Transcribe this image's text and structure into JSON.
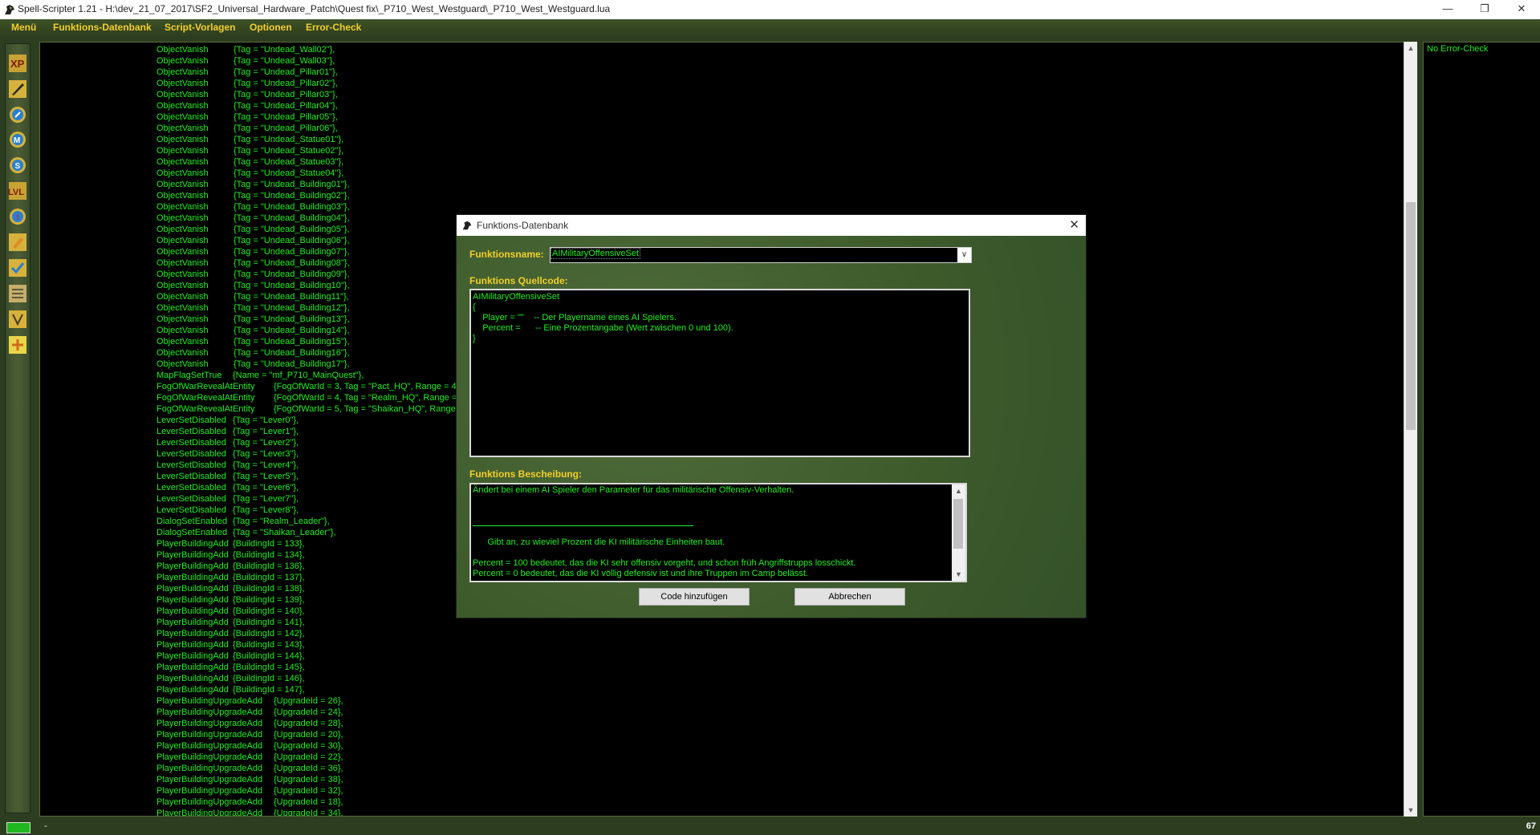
{
  "window": {
    "title": "Spell-Scripter 1.21 - H:\\dev_21_07_2017\\SF2_Universal_Hardware_Patch\\Quest fix\\_P710_West_Westguard\\_P710_West_Westguard.lua",
    "minimize": "—",
    "maximize": "❐",
    "close": "✕"
  },
  "menu": [
    "Menü",
    "Funktions-Datenbank",
    "Script-Vorlagen",
    "Optionen",
    "Error-Check"
  ],
  "toolbar": {
    "icons": [
      "xp-icon",
      "shovel-icon",
      "compass-icon",
      "m-icon",
      "s-icon",
      "lvl-icon",
      "info-icon",
      "pencil-icon",
      "check-icon",
      "list-icon",
      "map-icon",
      "plus-icon"
    ],
    "labels": {
      "xp": "XP",
      "lvl": "LVL",
      "m": "M",
      "s": "S",
      "info": "!"
    }
  },
  "code_lines": [
    [
      "ObjectVanish",
      "{Tag = \"Undead_Wall02\"},"
    ],
    [
      "ObjectVanish",
      "{Tag = \"Undead_Wall03\"},"
    ],
    [
      "ObjectVanish",
      "{Tag = \"Undead_Pillar01\"},"
    ],
    [
      "ObjectVanish",
      "{Tag = \"Undead_Pillar02\"},"
    ],
    [
      "ObjectVanish",
      "{Tag = \"Undead_Pillar03\"},"
    ],
    [
      "ObjectVanish",
      "{Tag = \"Undead_Pillar04\"},"
    ],
    [
      "ObjectVanish",
      "{Tag = \"Undead_Pillar05\"},"
    ],
    [
      "ObjectVanish",
      "{Tag = \"Undead_Pillar06\"},"
    ],
    [
      "ObjectVanish",
      "{Tag = \"Undead_Statue01\"},"
    ],
    [
      "ObjectVanish",
      "{Tag = \"Undead_Statue02\"},"
    ],
    [
      "ObjectVanish",
      "{Tag = \"Undead_Statue03\"},"
    ],
    [
      "ObjectVanish",
      "{Tag = \"Undead_Statue04\"},"
    ],
    [
      "ObjectVanish",
      "{Tag = \"Undead_Building01\"},"
    ],
    [
      "ObjectVanish",
      "{Tag = \"Undead_Building02\"},"
    ],
    [
      "ObjectVanish",
      "{Tag = \"Undead_Building03\"},"
    ],
    [
      "ObjectVanish",
      "{Tag = \"Undead_Building04\"},"
    ],
    [
      "ObjectVanish",
      "{Tag = \"Undead_Building05\"},"
    ],
    [
      "ObjectVanish",
      "{Tag = \"Undead_Building06\"},"
    ],
    [
      "ObjectVanish",
      "{Tag = \"Undead_Building07\"},"
    ],
    [
      "ObjectVanish",
      "{Tag = \"Undead_Building08\"},"
    ],
    [
      "ObjectVanish",
      "{Tag = \"Undead_Building09\"},"
    ],
    [
      "ObjectVanish",
      "{Tag = \"Undead_Building10\"},"
    ],
    [
      "ObjectVanish",
      "{Tag = \"Undead_Building11\"},"
    ],
    [
      "ObjectVanish",
      "{Tag = \"Undead_Building12\"},"
    ],
    [
      "ObjectVanish",
      "{Tag = \"Undead_Building13\"},"
    ],
    [
      "ObjectVanish",
      "{Tag = \"Undead_Building14\"},"
    ],
    [
      "ObjectVanish",
      "{Tag = \"Undead_Building15\"},"
    ],
    [
      "ObjectVanish",
      "{Tag = \"Undead_Building16\"},"
    ],
    [
      "ObjectVanish",
      "{Tag = \"Undead_Building17\"},"
    ],
    [
      "MapFlagSetTrue",
      "{Name = \"mf_P710_MainQuest\"},"
    ],
    [
      "FogOfWarRevealAtEntity",
      "{FogOfWarId = 3, Tag = \"Pact_HQ\", Range = 40"
    ],
    [
      "FogOfWarRevealAtEntity",
      "{FogOfWarId = 4, Tag = \"Realm_HQ\", Range = 4"
    ],
    [
      "FogOfWarRevealAtEntity",
      "{FogOfWarId = 5, Tag = \"Shaikan_HQ\", Range ="
    ],
    [
      "LeverSetDisabled",
      "{Tag = \"Lever0\"},"
    ],
    [
      "LeverSetDisabled",
      "{Tag = \"Lever1\"},"
    ],
    [
      "LeverSetDisabled",
      "{Tag = \"Lever2\"},"
    ],
    [
      "LeverSetDisabled",
      "{Tag = \"Lever3\"},"
    ],
    [
      "LeverSetDisabled",
      "{Tag = \"Lever4\"},"
    ],
    [
      "LeverSetDisabled",
      "{Tag = \"Lever5\"},"
    ],
    [
      "LeverSetDisabled",
      "{Tag = \"Lever6\"},"
    ],
    [
      "LeverSetDisabled",
      "{Tag = \"Lever7\"},"
    ],
    [
      "LeverSetDisabled",
      "{Tag = \"Lever8\"},"
    ],
    [
      "DialogSetEnabled",
      "{Tag = \"Realm_Leader\"},"
    ],
    [
      "DialogSetEnabled",
      "{Tag = \"Shaikan_Leader\"},"
    ],
    [
      "PlayerBuildingAdd",
      "{BuildingId = 133},"
    ],
    [
      "PlayerBuildingAdd",
      "{BuildingId = 134},"
    ],
    [
      "PlayerBuildingAdd",
      "{BuildingId = 136},"
    ],
    [
      "PlayerBuildingAdd",
      "{BuildingId = 137},"
    ],
    [
      "PlayerBuildingAdd",
      "{BuildingId = 138},"
    ],
    [
      "PlayerBuildingAdd",
      "{BuildingId = 139},"
    ],
    [
      "PlayerBuildingAdd",
      "{BuildingId = 140},"
    ],
    [
      "PlayerBuildingAdd",
      "{BuildingId = 141},"
    ],
    [
      "PlayerBuildingAdd",
      "{BuildingId = 142},"
    ],
    [
      "PlayerBuildingAdd",
      "{BuildingId = 143},"
    ],
    [
      "PlayerBuildingAdd",
      "{BuildingId = 144},"
    ],
    [
      "PlayerBuildingAdd",
      "{BuildingId = 145},"
    ],
    [
      "PlayerBuildingAdd",
      "{BuildingId = 146},"
    ],
    [
      "PlayerBuildingAdd",
      "{BuildingId = 147},"
    ],
    [
      "PlayerBuildingUpgradeAdd",
      "{UpgradeId = 26},"
    ],
    [
      "PlayerBuildingUpgradeAdd",
      "{UpgradeId = 24},"
    ],
    [
      "PlayerBuildingUpgradeAdd",
      "{UpgradeId = 28},"
    ],
    [
      "PlayerBuildingUpgradeAdd",
      "{UpgradeId = 20},"
    ],
    [
      "PlayerBuildingUpgradeAdd",
      "{UpgradeId = 30},"
    ],
    [
      "PlayerBuildingUpgradeAdd",
      "{UpgradeId = 22},"
    ],
    [
      "PlayerBuildingUpgradeAdd",
      "{UpgradeId = 36},"
    ],
    [
      "PlayerBuildingUpgradeAdd",
      "{UpgradeId = 38},"
    ],
    [
      "PlayerBuildingUpgradeAdd",
      "{UpgradeId = 32},"
    ],
    [
      "PlayerBuildingUpgradeAdd",
      "{UpgradeId = 18},"
    ],
    [
      "PlayerBuildingUpgradeAdd",
      "{UpgradeId = 34},"
    ]
  ],
  "error_panel": {
    "text": "No Error-Check"
  },
  "status": {
    "line": "67",
    "dash": "-"
  },
  "dialog": {
    "title": "Funktions-Datenbank",
    "close": "✕",
    "name_label": "Funktionsname:",
    "name_value": "AIMilitaryOffensiveSet",
    "source_label": "Funktions Quellcode:",
    "source_lines": [
      "AIMilitaryOffensiveSet",
      "{",
      "    Player = \"\"    -- Der Playername eines AI Spielers.",
      "    Percent =      -- Eine Prozentangabe (Wert zwischen 0 und 100).",
      "}"
    ],
    "desc_label": "Funktions Bescheibung:",
    "desc_lines": [
      "Ändert bei einem AI Spieler den Parameter für das militärische Offensiv-Verhalten.",
      "      Gibt an, zu wieviel Prozent die KI militärische Einheiten baut.",
      "Percent = 100 bedeutet, das die KI sehr offensiv vorgeht, und schon früh Angriffstrupps losschickt.",
      "Percent = 0 bedeutet, das die KI völlig defensiv ist und ihre Truppen im Camp belässt."
    ],
    "add_button": "Code hinzufügen",
    "cancel_button": "Abbrechen"
  },
  "colors": {
    "code_text": "#22ee22",
    "menu_text": "#f3cf2a",
    "panel_bg": "#3d5a2b"
  }
}
